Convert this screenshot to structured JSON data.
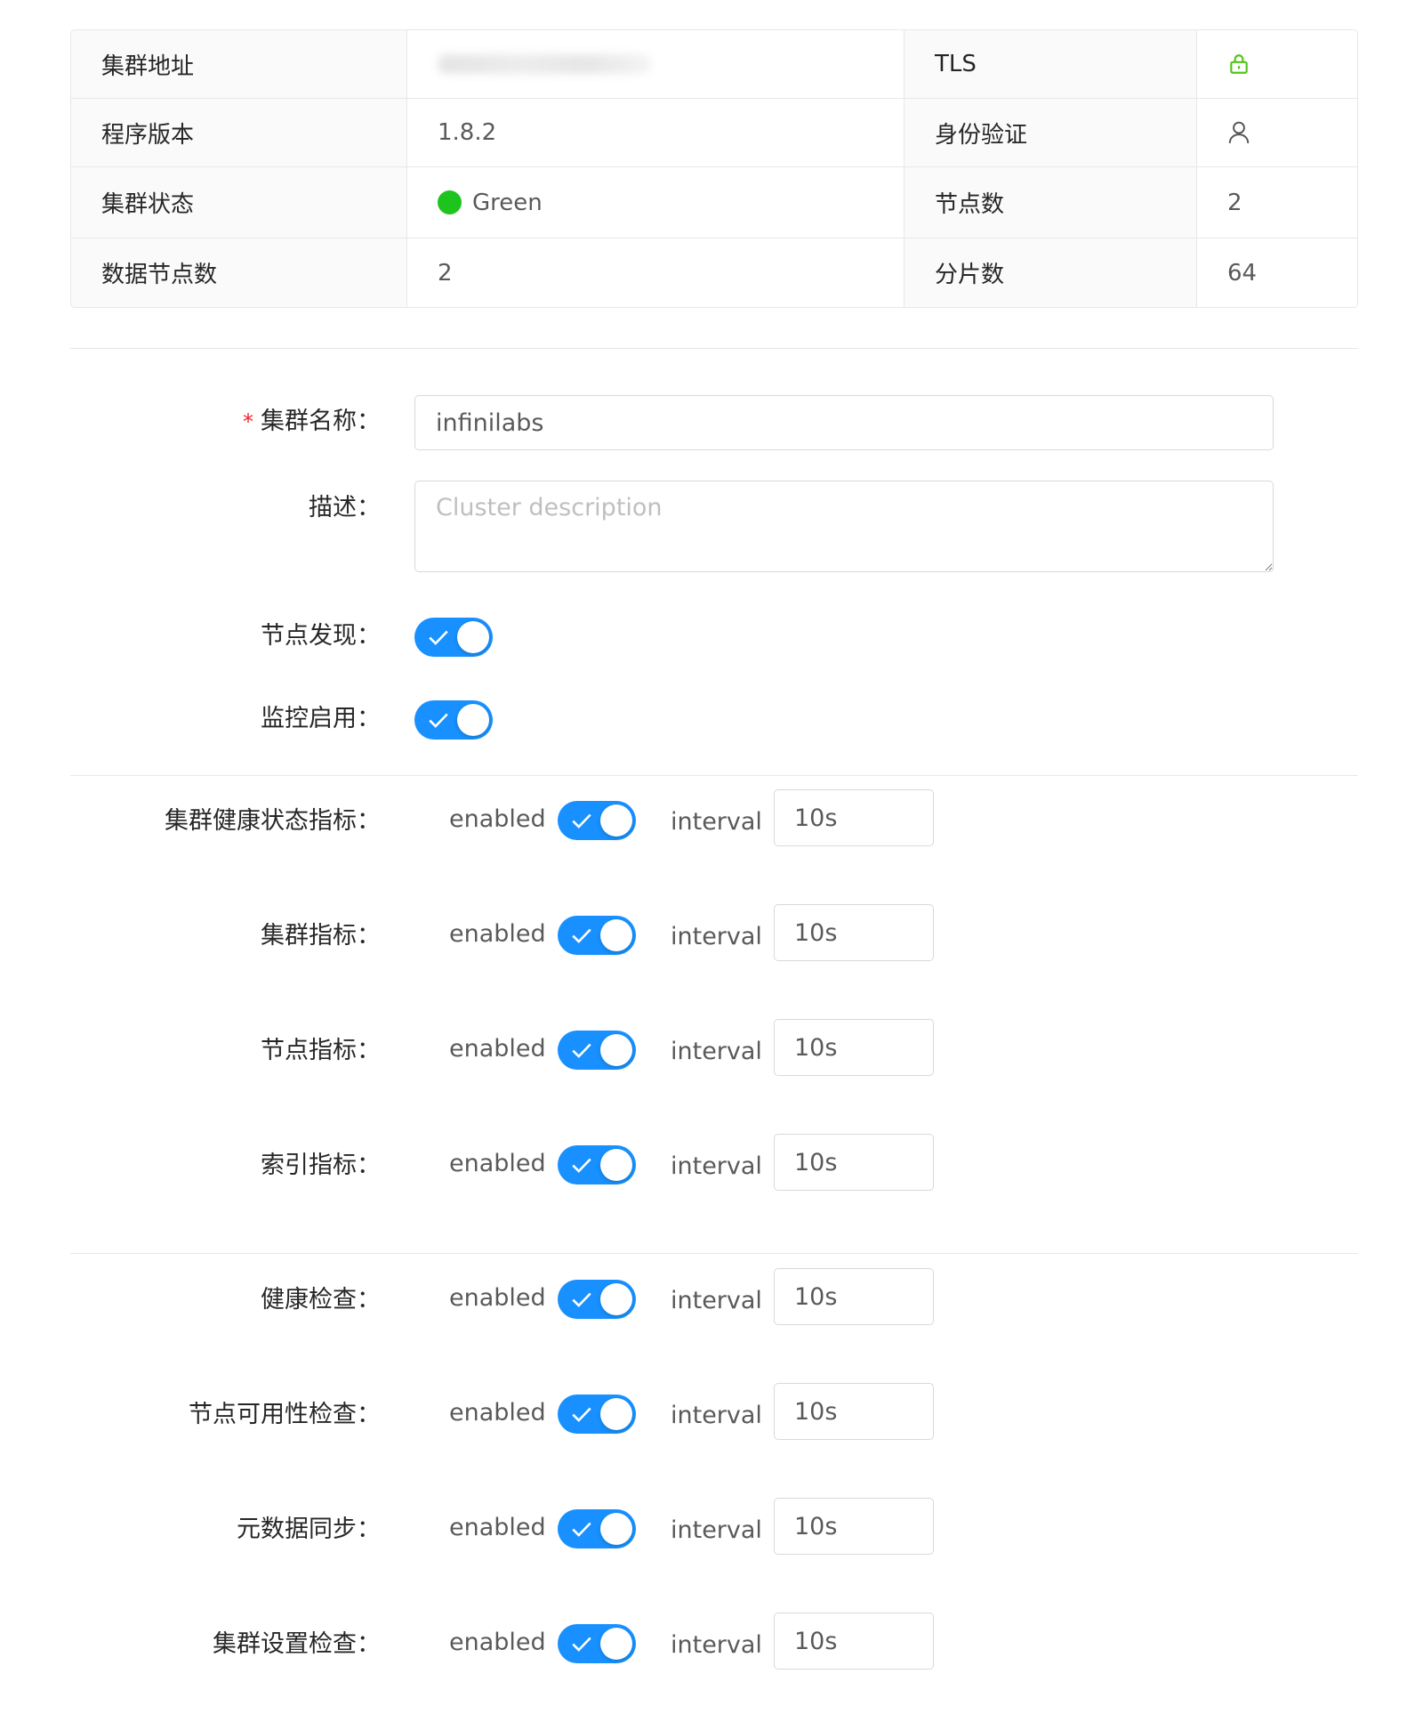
{
  "info": {
    "rows": [
      {
        "l1": "集群地址",
        "v1": "",
        "l2": "TLS",
        "v2_icon": "lock-icon"
      },
      {
        "l1": "程序版本",
        "v1": "1.8.2",
        "l2": "身份验证",
        "v2_icon": "user-icon"
      },
      {
        "l1": "集群状态",
        "v1": "Green",
        "l2": "节点数",
        "v2": "2"
      },
      {
        "l1": "数据节点数",
        "v1": "2",
        "l2": "分片数",
        "v2": "64"
      }
    ],
    "status_color": "#1ec41e",
    "tls_icon_color": "#52c41a"
  },
  "form": {
    "name_label": "集群名称",
    "name_value": "infinilabs",
    "required_mark": "*",
    "desc_label": "描述",
    "desc_placeholder": "Cluster description",
    "discovery_label": "节点发现",
    "discovery_enabled": true,
    "monitor_label": "监控启用",
    "monitor_enabled": true,
    "colon": "："
  },
  "metrics": [
    {
      "label": "集群健康状态指标",
      "enabled_text": "enabled",
      "interval_text": "interval",
      "interval": "10s",
      "enabled": true
    },
    {
      "label": "集群指标",
      "enabled_text": "enabled",
      "interval_text": "interval",
      "interval": "10s",
      "enabled": true
    },
    {
      "label": "节点指标",
      "enabled_text": "enabled",
      "interval_text": "interval",
      "interval": "10s",
      "enabled": true
    },
    {
      "label": "索引指标",
      "enabled_text": "enabled",
      "interval_text": "interval",
      "interval": "10s",
      "enabled": true
    }
  ],
  "checks": [
    {
      "label": "健康检查",
      "enabled_text": "enabled",
      "interval_text": "interval",
      "interval": "10s",
      "enabled": true
    },
    {
      "label": "节点可用性检查",
      "enabled_text": "enabled",
      "interval_text": "interval",
      "interval": "10s",
      "enabled": true
    },
    {
      "label": "元数据同步",
      "enabled_text": "enabled",
      "interval_text": "interval",
      "interval": "10s",
      "enabled": true
    },
    {
      "label": "集群设置检查",
      "enabled_text": "enabled",
      "interval_text": "interval",
      "interval": "10s",
      "enabled": true
    }
  ],
  "colors": {
    "accent": "#1890ff",
    "required": "#f5222d",
    "border": "#e8e8e8"
  }
}
